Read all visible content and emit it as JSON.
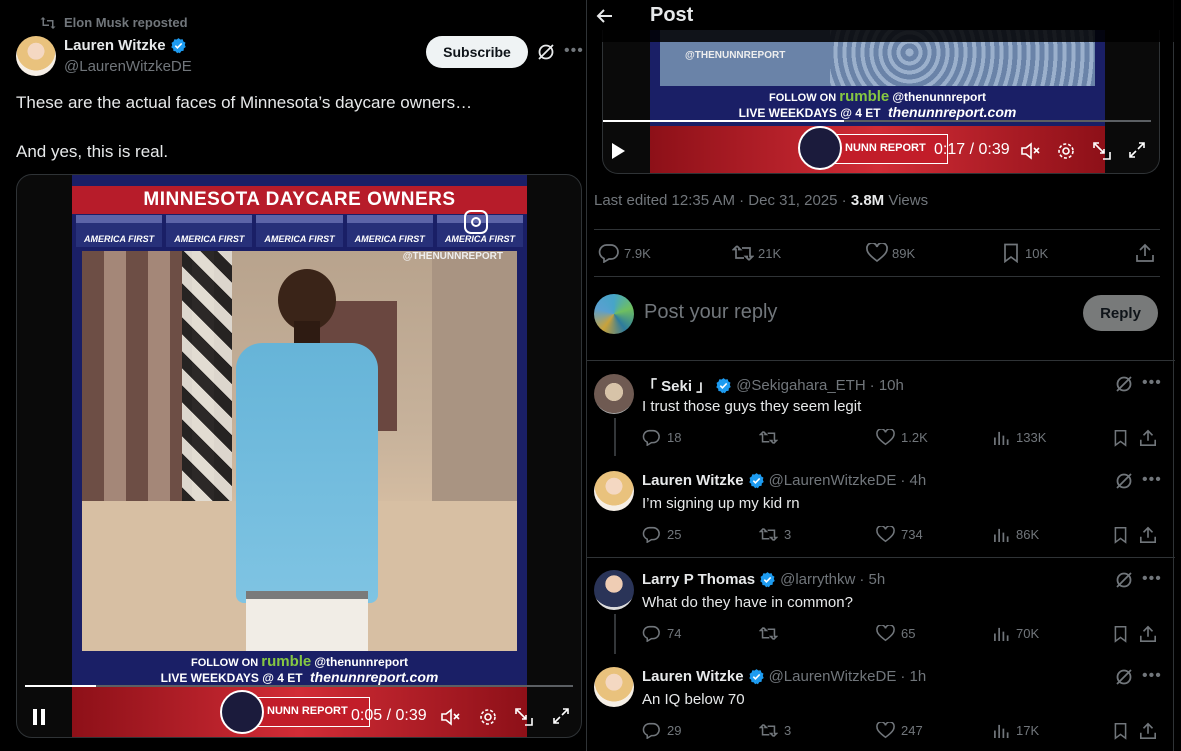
{
  "colors": {
    "background": "#000000",
    "text": "#e7e9ea",
    "muted": "#71767b",
    "verified": "#1d9bf0",
    "border": "#2f3336",
    "rumble_green": "#85c742",
    "banner_red": "#b71c2a"
  },
  "tweet": {
    "repost_label": "Elon Musk reposted",
    "author_name": "Lauren Witzke",
    "author_handle": "@LaurenWitzkeDE",
    "subscribe_label": "Subscribe",
    "text_line1": "These are the actual faces of Minnesota’s daycare owners…",
    "text_line2": "And yes, this is real.",
    "video": {
      "banner_title": "MINNESOTA DAYCARE OWNERS",
      "strip_label": "AMERICA FIRST",
      "watermark": "@THENUNNREPORT",
      "follow_on": "FOLLOW ON",
      "rumble": "rumble",
      "channel": "@thenunnreport",
      "live": "LIVE WEEKDAYS @ 4 ET",
      "site": "thenunnreport.com",
      "nunn_badge": "NUNN REPORT",
      "time": "0:05 / 0:39",
      "progress": 0.13
    }
  },
  "post_page": {
    "header_title": "Post",
    "video": {
      "watermark": "@THENUNNREPORT",
      "follow_on": "FOLLOW ON",
      "rumble": "rumble",
      "channel": "@thenunnreport",
      "live": "LIVE WEEKDAYS @ 4 ET",
      "site": "thenunnreport.com",
      "nunn_badge": "NUNN REPORT",
      "time": "0:17 / 0:39",
      "progress": 0.44
    },
    "meta": {
      "edited": "Last edited 12:35 AM · Dec 31, 2025 · ",
      "views_count": "3.8M",
      "views_label": " Views"
    },
    "stats": {
      "replies": "7.9K",
      "reposts": "21K",
      "likes": "89K",
      "bookmarks": "10K"
    },
    "reply_placeholder": "Post your reply",
    "reply_button": "Reply"
  },
  "replies": [
    {
      "name": "「 Seki 」",
      "handle": "@Sekigahara_ETH",
      "time": "· 10h",
      "text": "I trust those guys they seem legit",
      "replies": "18",
      "reposts": "",
      "likes": "1.2K",
      "views": "133K"
    },
    {
      "name": "Lauren Witzke",
      "handle": "@LaurenWitzkeDE",
      "time": "· 4h",
      "text": "I’m signing up my kid rn",
      "replies": "25",
      "reposts": "3",
      "likes": "734",
      "views": "86K"
    },
    {
      "name": "Larry P Thomas",
      "handle": "@larrythkw",
      "time": "· 5h",
      "text": "What do they have in common?",
      "replies": "74",
      "reposts": "",
      "likes": "65",
      "views": "70K"
    },
    {
      "name": "Lauren Witzke",
      "handle": "@LaurenWitzkeDE",
      "time": "· 1h",
      "text": "An IQ below 70",
      "replies": "29",
      "reposts": "3",
      "likes": "247",
      "views": "17K"
    }
  ]
}
